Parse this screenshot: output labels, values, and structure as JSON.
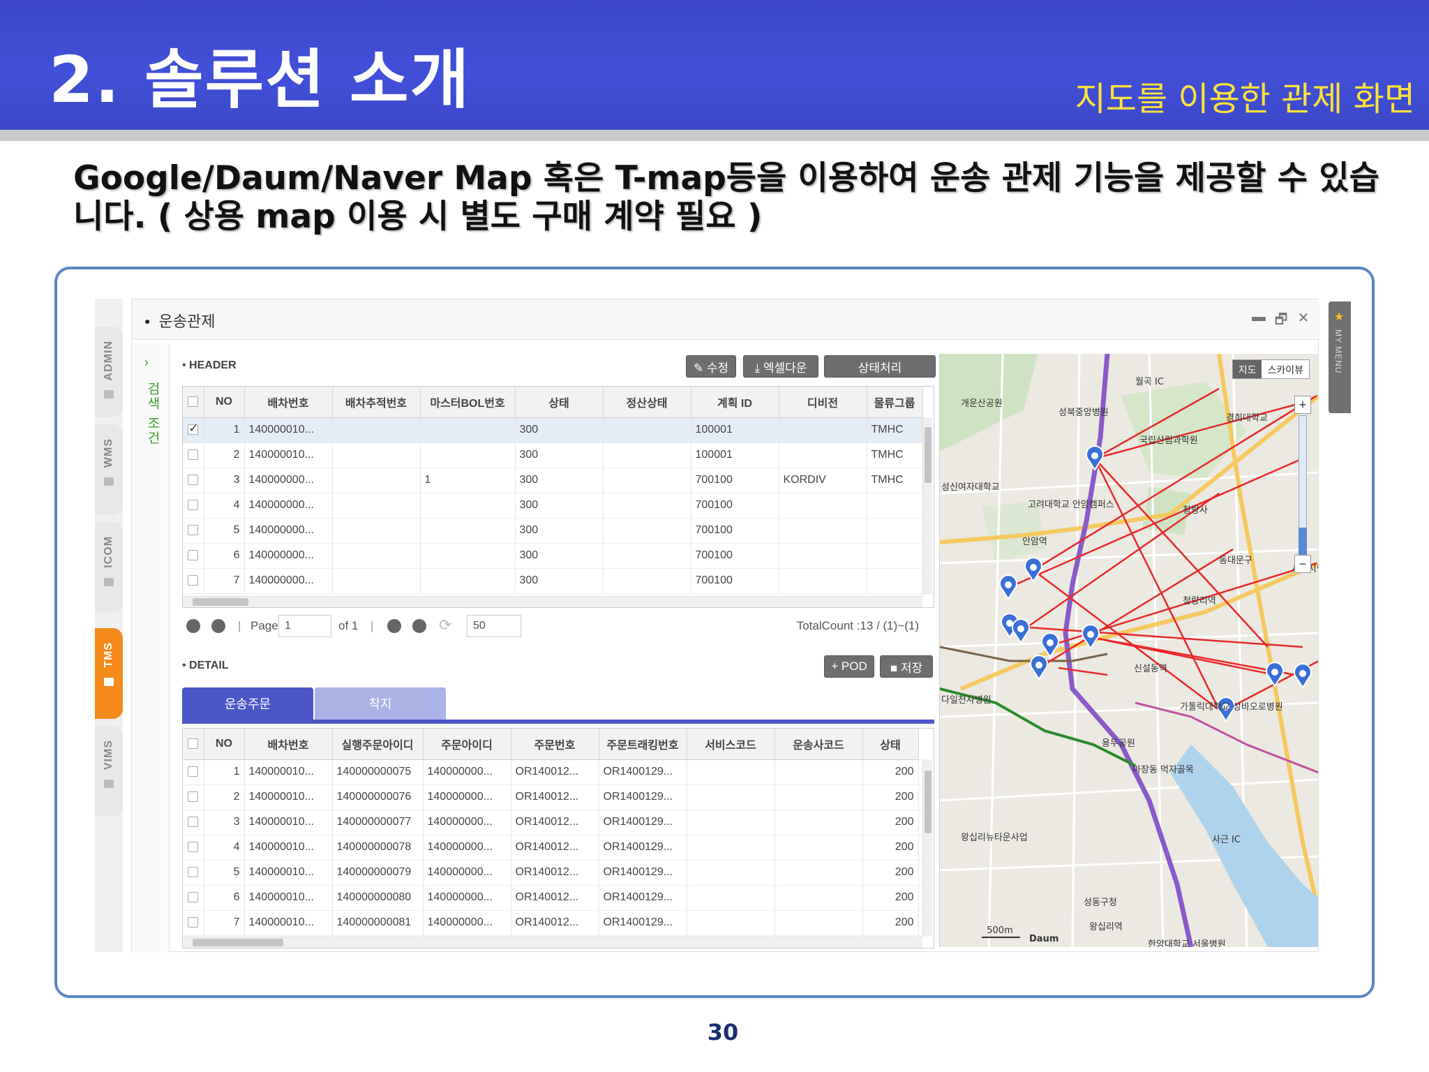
{
  "slide": {
    "title": "2. 솔루션 소개",
    "subtitle": "지도를 이용한 관제 화면",
    "intro_line1": "Google/Daum/Naver Map 혹은 T-map등을 이용하여 운송 관제 기능을 제공할 수 있습",
    "intro_line2": "니다. ( 상용 map 이용 시 별도 구매 계약 필요 )",
    "page_number": "30"
  },
  "app": {
    "side_tabs": [
      {
        "label": "ADMIN",
        "active": false
      },
      {
        "label": "WMS",
        "active": false
      },
      {
        "label": "ICOM",
        "active": false
      },
      {
        "label": "TMS",
        "active": true
      },
      {
        "label": "VIMS",
        "active": false
      }
    ],
    "window_title": "운송관제",
    "window_controls": {
      "minimize": "▬",
      "restore": "🗗",
      "close": "✕"
    },
    "search_label": "검색 조건",
    "search_chevron": "›",
    "my_menu": "MY MENU",
    "header": {
      "section_label": "HEADER",
      "buttons": {
        "edit": "✎ 수정",
        "excel": "⤓ 엑셀다운",
        "status": "상태처리"
      },
      "columns": [
        "NO",
        "배차번호",
        "배차추적번호",
        "마스터BOL번호",
        "상태",
        "정산상태",
        "계획 ID",
        "디비전",
        "물류그룹"
      ],
      "rows": [
        {
          "no": "1",
          "dispatch_no": "140000010...",
          "tracking_no": "",
          "master_bol": "",
          "status": "300",
          "settle": "",
          "plan_id": "100001",
          "division": "",
          "group": "TMHC",
          "checked": true
        },
        {
          "no": "2",
          "dispatch_no": "140000010...",
          "tracking_no": "",
          "master_bol": "",
          "status": "300",
          "settle": "",
          "plan_id": "100001",
          "division": "",
          "group": "TMHC",
          "checked": false
        },
        {
          "no": "3",
          "dispatch_no": "140000000...",
          "tracking_no": "",
          "master_bol": "1",
          "status": "300",
          "settle": "",
          "plan_id": "700100",
          "division": "KORDIV",
          "group": "TMHC",
          "checked": false
        },
        {
          "no": "4",
          "dispatch_no": "140000000...",
          "tracking_no": "",
          "master_bol": "",
          "status": "300",
          "settle": "",
          "plan_id": "700100",
          "division": "",
          "group": "",
          "checked": false
        },
        {
          "no": "5",
          "dispatch_no": "140000000...",
          "tracking_no": "",
          "master_bol": "",
          "status": "300",
          "settle": "",
          "plan_id": "700100",
          "division": "",
          "group": "",
          "checked": false
        },
        {
          "no": "6",
          "dispatch_no": "140000000...",
          "tracking_no": "",
          "master_bol": "",
          "status": "300",
          "settle": "",
          "plan_id": "700100",
          "division": "",
          "group": "",
          "checked": false
        },
        {
          "no": "7",
          "dispatch_no": "140000000...",
          "tracking_no": "",
          "master_bol": "",
          "status": "300",
          "settle": "",
          "plan_id": "700100",
          "division": "",
          "group": "",
          "checked": false
        }
      ],
      "pager": {
        "page_label": "Page",
        "page_value": "1",
        "of_label": "of 1",
        "page_size": "50",
        "total": "TotalCount :13 / (1)~(1)"
      }
    },
    "detail": {
      "section_label": "DETAIL",
      "buttons": {
        "pod": "+ POD",
        "save": "■ 저장"
      },
      "tabs": [
        {
          "label": "운송주문",
          "active": true
        },
        {
          "label": "착지",
          "active": false
        }
      ],
      "columns": [
        "NO",
        "배차번호",
        "실행주문아이디",
        "주문아이디",
        "주문번호",
        "주문트래킹번호",
        "서비스코드",
        "운송사코드",
        "상태"
      ],
      "rows": [
        {
          "no": "1",
          "dispatch_no": "140000010...",
          "exec_order_id": "140000000075",
          "order_id": "140000000...",
          "order_no": "OR140012...",
          "tracking_no": "OR1400129...",
          "service_code": "",
          "carrier_code": "",
          "status": "200"
        },
        {
          "no": "2",
          "dispatch_no": "140000010...",
          "exec_order_id": "140000000076",
          "order_id": "140000000...",
          "order_no": "OR140012...",
          "tracking_no": "OR1400129...",
          "service_code": "",
          "carrier_code": "",
          "status": "200"
        },
        {
          "no": "3",
          "dispatch_no": "140000010...",
          "exec_order_id": "140000000077",
          "order_id": "140000000...",
          "order_no": "OR140012...",
          "tracking_no": "OR1400129...",
          "service_code": "",
          "carrier_code": "",
          "status": "200"
        },
        {
          "no": "4",
          "dispatch_no": "140000010...",
          "exec_order_id": "140000000078",
          "order_id": "140000000...",
          "order_no": "OR140012...",
          "tracking_no": "OR1400129...",
          "service_code": "",
          "carrier_code": "",
          "status": "200"
        },
        {
          "no": "5",
          "dispatch_no": "140000010...",
          "exec_order_id": "140000000079",
          "order_id": "140000000...",
          "order_no": "OR140012...",
          "tracking_no": "OR1400129...",
          "service_code": "",
          "carrier_code": "",
          "status": "200"
        },
        {
          "no": "6",
          "dispatch_no": "140000010...",
          "exec_order_id": "140000000080",
          "order_id": "140000000...",
          "order_no": "OR140012...",
          "tracking_no": "OR1400129...",
          "service_code": "",
          "carrier_code": "",
          "status": "200"
        },
        {
          "no": "7",
          "dispatch_no": "140000010...",
          "exec_order_id": "140000000081",
          "order_id": "140000000...",
          "order_no": "OR140012...",
          "tracking_no": "OR1400129...",
          "service_code": "",
          "carrier_code": "",
          "status": "200"
        }
      ]
    },
    "map": {
      "type_buttons": {
        "map": "지도",
        "skyview": "스카이뷰"
      },
      "zoom_in": "+",
      "zoom_out": "−",
      "scale": "500m",
      "provider": "Daum",
      "places": [
        "개운산공원",
        "성북중앙병원",
        "국립산림과학원",
        "경희대학교",
        "성신여자대학교",
        "고려대학교 안암캠퍼스",
        "청량사",
        "안암역",
        "동대문구",
        "서울시립대학",
        "청량리역",
        "신설동역",
        "가톨릭대학교 성바오로병원",
        "다일천사병원",
        "용두공원",
        "마장동 먹자골목",
        "왕십리뉴타운사업",
        "성동구청",
        "왕십리역",
        "한양대학교 서울병원",
        "월곡 IC",
        "사근 IC"
      ],
      "colors": {
        "route": "#e8282a",
        "line6": "#8a5ac8",
        "line1": "#2a8c2a",
        "road": "#f6c85e",
        "pin": "#3a6fd6"
      }
    }
  }
}
